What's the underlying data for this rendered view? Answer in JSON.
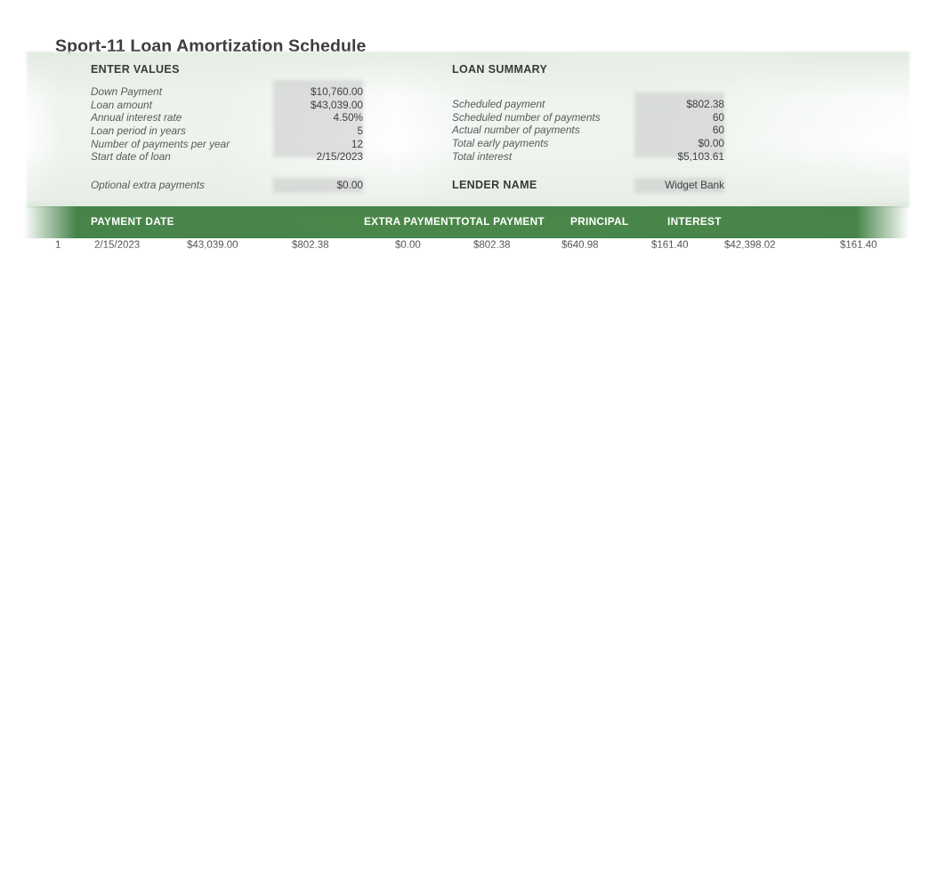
{
  "page": {
    "title": "Sport-11 Loan Amortization Schedule"
  },
  "theme": {
    "header_green": "#46834a",
    "panel_wash": "#e6ede5",
    "input_shade": "#c4c4c4",
    "text": "#404040"
  },
  "enter_values": {
    "heading": "ENTER VALUES",
    "rows": [
      {
        "label": "Down Payment",
        "value": "$10,760.00"
      },
      {
        "label": "Loan amount",
        "value": "$43,039.00"
      },
      {
        "label": "Annual interest rate",
        "value": "4.50%"
      },
      {
        "label": "Loan period in years",
        "value": "5"
      },
      {
        "label": "Number of payments per year",
        "value": "12"
      },
      {
        "label": "Start date of loan",
        "value": "2/15/2023"
      }
    ],
    "extra": {
      "label": "Optional extra payments",
      "value": "$0.00"
    }
  },
  "loan_summary": {
    "heading": "LOAN SUMMARY",
    "rows": [
      {
        "label": "Scheduled payment",
        "value": "$802.38"
      },
      {
        "label": "Scheduled number of payments",
        "value": "60"
      },
      {
        "label": "Actual number of payments",
        "value": "60"
      },
      {
        "label": "Total early payments",
        "value": "$0.00"
      },
      {
        "label": "Total interest",
        "value": "$5,103.61"
      }
    ],
    "lender": {
      "label": "LENDER NAME",
      "value": "Widget Bank"
    }
  },
  "schedule": {
    "columns": [
      {
        "key": "pmt_no",
        "label": ""
      },
      {
        "key": "payment_date",
        "label": "PAYMENT DATE"
      },
      {
        "key": "beginning_bal",
        "label": ""
      },
      {
        "key": "scheduled_pmt",
        "label": ""
      },
      {
        "key": "extra_payment",
        "label": "EXTRA PAYMENT"
      },
      {
        "key": "total_payment",
        "label": "TOTAL PAYMENT"
      },
      {
        "key": "principal",
        "label": "PRINCIPAL"
      },
      {
        "key": "interest",
        "label": "INTEREST"
      },
      {
        "key": "ending_bal",
        "label": ""
      },
      {
        "key": "cum_interest",
        "label": ""
      }
    ],
    "rows": [
      {
        "pmt_no": "1",
        "payment_date": "2/15/2023",
        "beginning_bal": "$43,039.00",
        "scheduled_pmt": "$802.38",
        "extra_payment": "$0.00",
        "total_payment": "$802.38",
        "principal": "$640.98",
        "interest": "$161.40",
        "ending_bal": "$42,398.02",
        "cum_interest": "$161.40"
      }
    ],
    "ghost_row": {
      "pmt_no": "",
      "payment_date": "",
      "beginning_bal": "",
      "scheduled_pmt": "",
      "extra_payment": "",
      "total_payment": "",
      "principal": "",
      "interest": "",
      "ending_bal": "",
      "cum_interest": ""
    }
  }
}
